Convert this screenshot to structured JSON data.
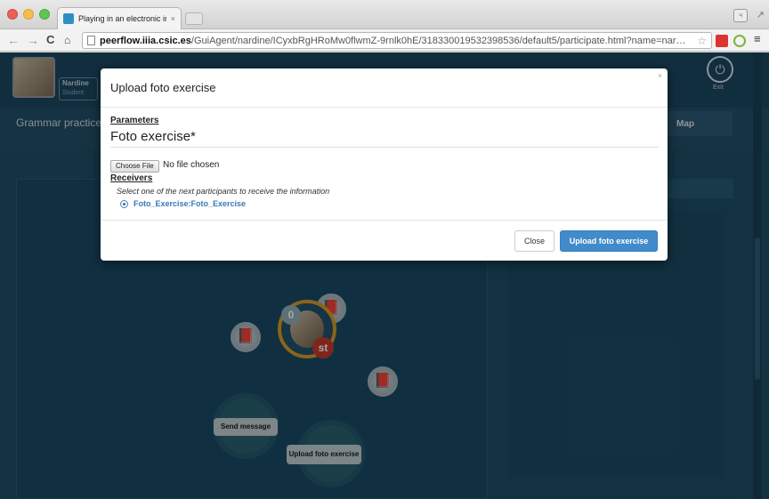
{
  "browser": {
    "tab_title": "Playing in an electronic in…",
    "tab_close": "×",
    "url_domain": "peerflow.iiia.csic.es",
    "url_path": "/GuiAgent/nardine/ICyxbRgHRoMw0flwmZ-9rnlk0hE/318330019532398536/default5/participate.html?name=nar…",
    "nav_back": "←",
    "nav_forward": "→",
    "nav_reload": "C",
    "nav_home": "⌂",
    "star": "☆",
    "menu": "≡",
    "profile": "♃",
    "fullscreen": "↗"
  },
  "app": {
    "user_name": "Nardine",
    "user_role": "Student",
    "exit_icon": "⏻",
    "exit_label": "Exit",
    "activity_title": "Grammar practice",
    "map_label": "Map",
    "book_icon": "📕",
    "counter": "0",
    "role_badge": "st",
    "gears": [
      "Send message",
      "Upload foto exercise"
    ]
  },
  "modal": {
    "title": "Upload foto exercise",
    "close_x": "×",
    "parameters_heading": "Parameters",
    "parameter_name": "Foto exercise*",
    "choose_file_label": "Choose File",
    "no_file_text": "No file chosen",
    "receivers_heading": "Receivers",
    "receivers_help": "Select one of the next participants to receive the information",
    "participant": "Foto_Exercise:Foto_Exercise",
    "close_button": "Close",
    "submit_button": "Upload foto exercise"
  },
  "colors": {
    "app_background": "#1e4d66",
    "primary_button": "#428bca",
    "link_blue": "#3a78b6",
    "ring_orange": "#d49a2a",
    "badge_red": "#c53a2c"
  }
}
